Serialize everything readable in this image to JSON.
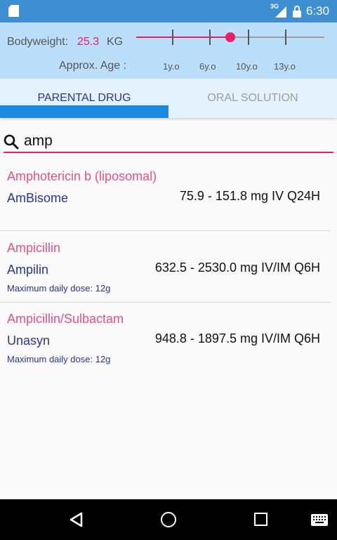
{
  "status_bar": {
    "network": "3G",
    "time": "6:30"
  },
  "top_panel": {
    "bodyweight_label": "Bodyweight:",
    "bodyweight_value": "25.3",
    "bodyweight_unit": "KG",
    "age_label": "Approx. Age :",
    "age_ticks": [
      "1y.o",
      "6y.o",
      "10y.o",
      "13y.o"
    ]
  },
  "tabs": [
    {
      "label": "PARENTAL DRUG",
      "active": true
    },
    {
      "label": "ORAL SOLUTION",
      "active": false
    }
  ],
  "search": {
    "value": "amp"
  },
  "results": [
    {
      "generic": "Amphotericin b (liposomal)",
      "brand": "AmBisome",
      "dose": "75.9 - 151.8 mg IV Q24H",
      "max_daily": ""
    },
    {
      "generic": "Ampicillin",
      "brand": "Ampilin",
      "dose": "632.5 - 2530.0 mg IV/IM Q6H",
      "max_daily": "Maximum daily dose: 12g"
    },
    {
      "generic": "Ampicillin/Sulbactam",
      "brand": "Unasyn",
      "dose": "948.8 - 1897.5 mg IV/IM Q6H",
      "max_daily": "Maximum daily dose: 12g"
    }
  ],
  "colors": {
    "accent": "#e91e63",
    "primary": "#1e88e5",
    "status_bar": "#3d8fd1",
    "panel": "#bbdefb",
    "brand_text": "#283593"
  }
}
